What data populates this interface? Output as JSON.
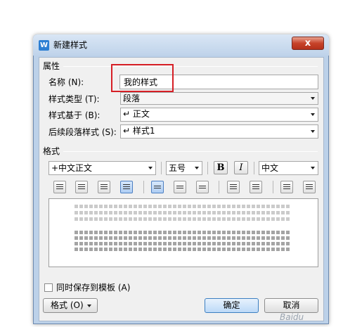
{
  "window": {
    "title": "新建样式",
    "close_glyph": "x",
    "app_icon_glyph": "W"
  },
  "properties": {
    "group_label": "属性",
    "name_label": "名称 (N):",
    "name_value": "我的样式",
    "style_type_label": "样式类型 (T):",
    "style_type_value": "段落",
    "based_on_label": "样式基于 (B):",
    "based_on_value": "↵ 正文",
    "next_style_label": "后续段落样式 (S):",
    "next_style_value": "↵ 样式1"
  },
  "format": {
    "group_label": "格式",
    "font_value": "+中文正文",
    "size_value": "五号",
    "bold_label": "B",
    "italic_label": "I",
    "lang_value": "中文"
  },
  "footer": {
    "add_to_template_label": "同时保存到模板 (A)",
    "format_menu_label": "格式 (O)",
    "ok_label": "确定",
    "cancel_label": "取消"
  },
  "watermark": "Baidu"
}
